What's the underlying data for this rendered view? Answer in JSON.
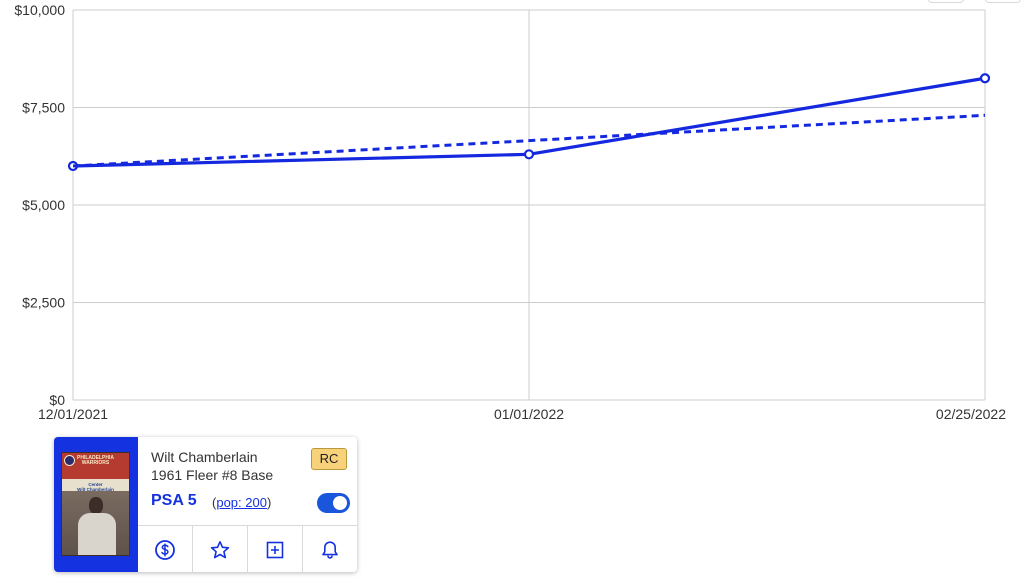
{
  "chart_data": {
    "type": "line",
    "x": [
      "12/01/2021",
      "01/01/2022",
      "02/25/2022"
    ],
    "x_ticks": [
      "12/01/2021",
      "01/01/2022",
      "02/25/2022"
    ],
    "y_ticks": [
      "$0",
      "$2,500",
      "$5,000",
      "$7,500",
      "$10,000"
    ],
    "ylim": [
      0,
      10000
    ],
    "grid": true,
    "series": [
      {
        "style": "solid",
        "values": [
          6000,
          6300,
          8250
        ],
        "markers": true
      },
      {
        "style": "dashed",
        "values": [
          6000,
          6650,
          7300
        ],
        "markers": false
      }
    ],
    "colors": {
      "line": "#1428e0",
      "grid": "#cccccc"
    }
  },
  "card": {
    "player": "Wilt Chamberlain",
    "set": "1961 Fleer #8 Base",
    "badge": "RC",
    "grade": "PSA 5",
    "pop_open": "(",
    "pop_link": "pop: 200",
    "pop_close": ")",
    "toggle_on": true,
    "thumbnail": {
      "team_banner": "Philadelphia Warriors",
      "caption_position": "Center",
      "caption_name": "Wilt Chamberlain"
    },
    "actions": [
      "dollar-icon",
      "star-icon",
      "add-box-icon",
      "bell-icon"
    ],
    "accent_color": "#1432e0"
  }
}
